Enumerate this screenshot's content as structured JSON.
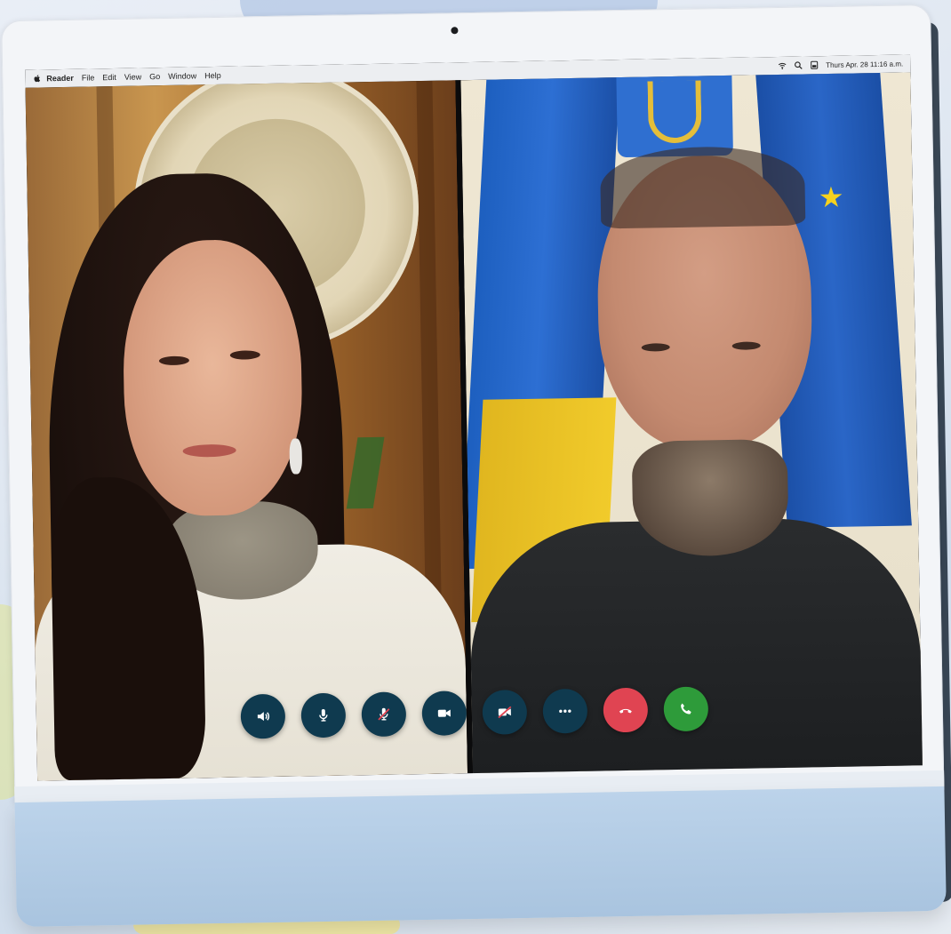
{
  "menubar": {
    "app_name": "Reader",
    "items": [
      "File",
      "Edit",
      "View",
      "Go",
      "Window",
      "Help"
    ],
    "clock": "Thurs Apr. 28 11:16 a.m."
  },
  "participants": {
    "left": {
      "description_icon": "video-feed"
    },
    "right": {
      "description_icon": "video-feed"
    }
  },
  "controls": {
    "buttons": [
      {
        "name": "speaker-button",
        "icon": "speaker-icon",
        "color": "#0f3a4f"
      },
      {
        "name": "mic-button",
        "icon": "microphone-icon",
        "color": "#0f3a4f"
      },
      {
        "name": "mute-mic-button",
        "icon": "microphone-off-icon",
        "color": "#0f3a4f"
      },
      {
        "name": "camera-button",
        "icon": "video-camera-icon",
        "color": "#0f3a4f"
      },
      {
        "name": "camera-off-button",
        "icon": "video-camera-off-icon",
        "color": "#0f3a4f"
      },
      {
        "name": "more-options-button",
        "icon": "ellipsis-icon",
        "color": "#0f3a4f"
      },
      {
        "name": "end-call-button",
        "icon": "hang-up-icon",
        "color": "#e04452"
      },
      {
        "name": "answer-call-button",
        "icon": "phone-icon",
        "color": "#2e9b3a"
      }
    ]
  }
}
